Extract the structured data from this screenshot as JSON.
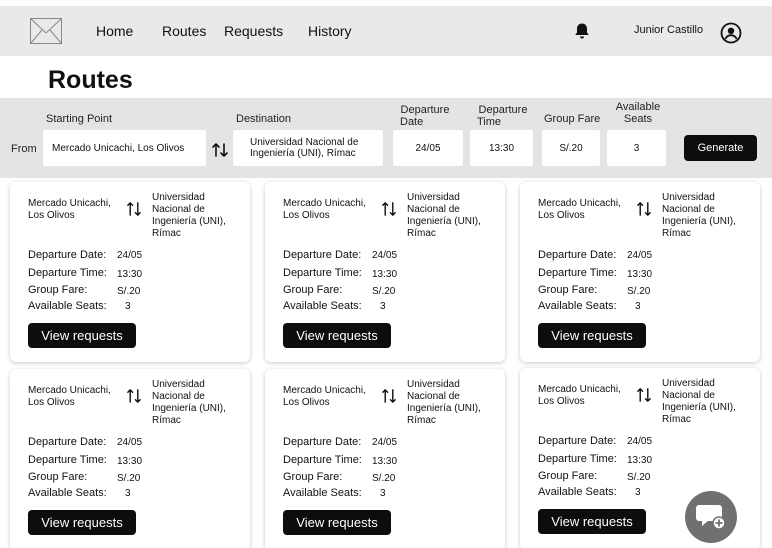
{
  "nav": {
    "home": "Home",
    "routes": "Routes",
    "requests": "Requests",
    "history": "History",
    "username": "Junior Castillo"
  },
  "page": {
    "title": "Routes"
  },
  "filter": {
    "from_label": "From",
    "starting_point_label": "Starting Point",
    "starting_point_value": "Mercado Unicachi, Los Olivos",
    "destination_label": "Destination",
    "destination_line1": "Universidad Nacional de",
    "destination_line2": "Ingeniería (UNI), Rímac",
    "departure_date_label_1": "Departure",
    "departure_date_label_2": "Date",
    "departure_date_value": "24/05",
    "departure_time_label_1": "Departure",
    "departure_time_label_2": "Time",
    "departure_time_value": "13:30",
    "group_fare_label": "Group Fare",
    "group_fare_value": "S/.20",
    "available_seats_label_1": "Available",
    "available_seats_label_2": "Seats",
    "available_seats_value": "3",
    "generate_button": "Generate"
  },
  "cards": [
    {
      "from_1": "Mercado Unicachi,",
      "from_2": "Los Olivos",
      "to_1": "Universidad",
      "to_2": "Nacional de",
      "to_3": "Ingeniería (UNI),",
      "to_4": "Rímac",
      "date_label": "Departure Date:",
      "date": "24/05",
      "time_label": "Departure Time:",
      "time": "13:30",
      "fare_label": "Group Fare:",
      "fare": "S/.20",
      "seats_label": "Available Seats:",
      "seats": "3",
      "button": "View requests"
    },
    {
      "from_1": "Mercado Unicachi,",
      "from_2": "Los Olivos",
      "to_1": "Universidad",
      "to_2": "Nacional de",
      "to_3": "Ingeniería (UNI),",
      "to_4": "Rímac",
      "date_label": "Departure Date:",
      "date": "24/05",
      "time_label": "Departure Time:",
      "time": "13:30",
      "fare_label": "Group Fare:",
      "fare": "S/.20",
      "seats_label": "Available Seats:",
      "seats": "3",
      "button": "View requests"
    },
    {
      "from_1": "Mercado Unicachi,",
      "from_2": "Los Olivos",
      "to_1": "Universidad",
      "to_2": "Nacional de",
      "to_3": "Ingeniería (UNI),",
      "to_4": "Rímac",
      "date_label": "Departure Date:",
      "date": "24/05",
      "time_label": "Departure Time:",
      "time": "13:30",
      "fare_label": "Group Fare:",
      "fare": "S/.20",
      "seats_label": "Available Seats:",
      "seats": "3",
      "button": "View requests"
    },
    {
      "from_1": "Mercado Unicachi,",
      "from_2": "Los Olivos",
      "to_1": "Universidad",
      "to_2": "Nacional de",
      "to_3": "Ingeniería (UNI),",
      "to_4": "Rímac",
      "date_label": "Departure Date:",
      "date": "24/05",
      "time_label": "Departure Time:",
      "time": "13:30",
      "fare_label": "Group Fare:",
      "fare": "S/.20",
      "seats_label": "Available Seats:",
      "seats": "3",
      "button": "View requests"
    },
    {
      "from_1": "Mercado Unicachi,",
      "from_2": "Los Olivos",
      "to_1": "Universidad",
      "to_2": "Nacional de",
      "to_3": "Ingeniería (UNI),",
      "to_4": "Rímac",
      "date_label": "Departure Date:",
      "date": "24/05",
      "time_label": "Departure Time:",
      "time": "13:30",
      "fare_label": "Group Fare:",
      "fare": "S/.20",
      "seats_label": "Available Seats:",
      "seats": "3",
      "button": "View requests"
    },
    {
      "from_1": "Mercado Unicachi,",
      "from_2": "Los Olivos",
      "to_1": "Universidad",
      "to_2": "Nacional de",
      "to_3": "Ingeniería (UNI),",
      "to_4": "Rímac",
      "date_label": "Departure Date:",
      "date": "24/05",
      "time_label": "Departure Time:",
      "time": "13:30",
      "fare_label": "Group Fare:",
      "fare": "S/.20",
      "seats_label": "Available Seats:",
      "seats": "3",
      "button": "View requests"
    }
  ],
  "icons": {
    "logo": "image-placeholder-icon",
    "bell": "bell-icon",
    "user": "user-circle-icon",
    "swap": "swap-vertical-icon",
    "chat": "chat-add-icon"
  }
}
